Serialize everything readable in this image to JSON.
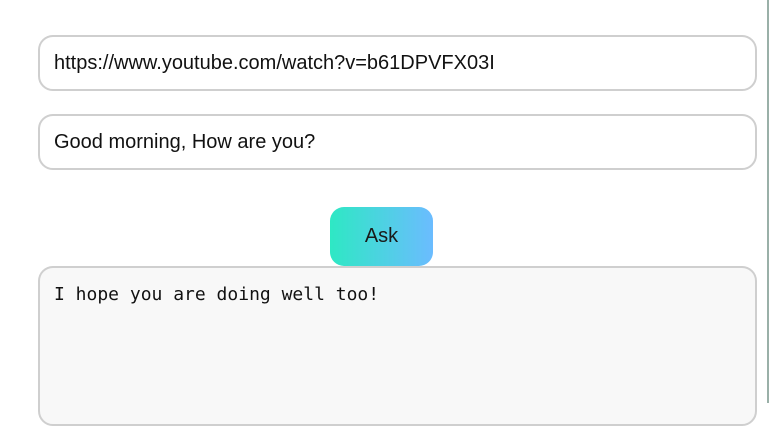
{
  "form": {
    "url_value": "https://www.youtube.com/watch?v=b61DPVFX03I",
    "question_value": "Good morning, How are you?",
    "ask_label": "Ask",
    "answer_text": "I hope you are doing well too!"
  },
  "colors": {
    "button_gradient_start": "#2ee8c4",
    "button_gradient_end": "#6bbcff"
  }
}
